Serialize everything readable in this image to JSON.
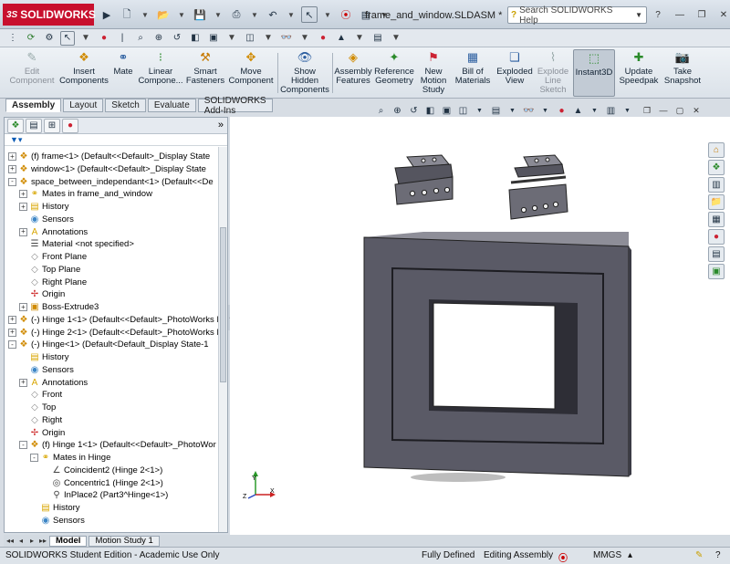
{
  "app": {
    "logo_text": "SOLIDWORKS",
    "logo_mark": "3S",
    "document_title": "frame_and_window.SLDASM *"
  },
  "search": {
    "placeholder": "Search SOLIDWORKS Help",
    "icon": "question-icon"
  },
  "window_controls": [
    "help-icon",
    "minimize-icon",
    "restore-icon",
    "close-icon"
  ],
  "command_manager": [
    {
      "label": "Edit Component",
      "icon": "edit-component-icon",
      "enabled": false
    },
    {
      "label": "Insert Components",
      "icon": "insert-components-icon",
      "enabled": true
    },
    {
      "label": "Mate",
      "icon": "mate-icon",
      "enabled": true
    },
    {
      "label": "Linear Compone...",
      "icon": "linear-pattern-icon",
      "enabled": true
    },
    {
      "label": "Smart Fasteners",
      "icon": "smart-fasteners-icon",
      "enabled": true
    },
    {
      "label": "Move Component",
      "icon": "move-component-icon",
      "enabled": true
    },
    {
      "label": "Show Hidden Components",
      "icon": "show-hidden-icon",
      "enabled": true
    },
    {
      "label": "Assembly Features",
      "icon": "assembly-features-icon",
      "enabled": true
    },
    {
      "label": "Reference Geometry",
      "icon": "reference-geometry-icon",
      "enabled": true
    },
    {
      "label": "New Motion Study",
      "icon": "motion-study-icon",
      "enabled": true
    },
    {
      "label": "Bill of Materials",
      "icon": "bom-icon",
      "enabled": true
    },
    {
      "label": "Exploded View",
      "icon": "exploded-view-icon",
      "enabled": true
    },
    {
      "label": "Explode Line Sketch",
      "icon": "explode-line-icon",
      "enabled": false
    },
    {
      "label": "Instant3D",
      "icon": "instant3d-icon",
      "enabled": true,
      "active": true
    },
    {
      "label": "Update Speedpak",
      "icon": "speedpak-icon",
      "enabled": true
    },
    {
      "label": "Take Snapshot",
      "icon": "snapshot-icon",
      "enabled": true
    }
  ],
  "command_tabs": [
    {
      "label": "Assembly",
      "active": true
    },
    {
      "label": "Layout",
      "active": false
    },
    {
      "label": "Sketch",
      "active": false
    },
    {
      "label": "Evaluate",
      "active": false
    },
    {
      "label": "SOLIDWORKS Add-Ins",
      "active": false
    }
  ],
  "feature_tree": [
    {
      "label": "(f) frame<1> (Default<<Default>_Display State",
      "icon": "part",
      "toggle": "+"
    },
    {
      "label": "window<1> (Default<<Default>_Display State",
      "icon": "part",
      "toggle": "+"
    },
    {
      "label": "space_between_independant<1> (Default<<De",
      "icon": "part",
      "toggle": "-"
    },
    {
      "label": "Mates in frame_and_window",
      "icon": "mates",
      "toggle": "+"
    },
    {
      "label": "History",
      "icon": "folder",
      "toggle": "+"
    },
    {
      "label": "Sensors",
      "icon": "sensor",
      "toggle": ""
    },
    {
      "label": "Annotations",
      "icon": "annotation",
      "toggle": "+"
    },
    {
      "label": "Material <not specified>",
      "icon": "material",
      "toggle": ""
    },
    {
      "label": "Front Plane",
      "icon": "plane",
      "toggle": ""
    },
    {
      "label": "Top Plane",
      "icon": "plane",
      "toggle": ""
    },
    {
      "label": "Right Plane",
      "icon": "plane",
      "toggle": ""
    },
    {
      "label": "Origin",
      "icon": "origin",
      "toggle": ""
    },
    {
      "label": "Boss-Extrude3",
      "icon": "extrude",
      "toggle": "+"
    },
    {
      "label": "(-) Hinge 1<1> (Default<<Default>_PhotoWorks I",
      "icon": "part",
      "toggle": "+"
    },
    {
      "label": "(-) Hinge 2<1> (Default<<Default>_PhotoWorks I",
      "icon": "part",
      "toggle": "+"
    },
    {
      "label": "(-) Hinge<1> (Default<Default_Display State-1",
      "icon": "part",
      "toggle": "-"
    },
    {
      "label": "History",
      "icon": "folder",
      "toggle": ""
    },
    {
      "label": "Sensors",
      "icon": "sensor",
      "toggle": ""
    },
    {
      "label": "Annotations",
      "icon": "annotation",
      "toggle": "+"
    },
    {
      "label": "Front",
      "icon": "plane",
      "toggle": ""
    },
    {
      "label": "Top",
      "icon": "plane",
      "toggle": ""
    },
    {
      "label": "Right",
      "icon": "plane",
      "toggle": ""
    },
    {
      "label": "Origin",
      "icon": "origin",
      "toggle": ""
    },
    {
      "label": "(f) Hinge 1<1> (Default<<Default>_PhotoWor",
      "icon": "part",
      "toggle": "-"
    },
    {
      "label": "Mates in Hinge",
      "icon": "mates",
      "toggle": "-"
    },
    {
      "label": "Coincident2 (Hinge 2<1>)",
      "icon": "coincident",
      "toggle": ""
    },
    {
      "label": "Concentric1 (Hinge 2<1>)",
      "icon": "concentric",
      "toggle": ""
    },
    {
      "label": "InPlace2 (Part3^Hinge<1>)",
      "icon": "inplace",
      "toggle": ""
    },
    {
      "label": "History",
      "icon": "folder",
      "toggle": ""
    },
    {
      "label": "Sensors",
      "icon": "sensor",
      "toggle": ""
    }
  ],
  "bottom_tabs": [
    {
      "label": "Model",
      "active": true
    },
    {
      "label": "Motion Study 1",
      "active": false
    }
  ],
  "status": {
    "edition": "SOLIDWORKS Student Edition - Academic Use Only",
    "definition": "Fully Defined",
    "mode": "Editing Assembly",
    "units": "MMGS"
  },
  "colors": {
    "brand": "#c8102e",
    "frame_face": "#5b5b66",
    "hinge": "#6a6a72"
  }
}
